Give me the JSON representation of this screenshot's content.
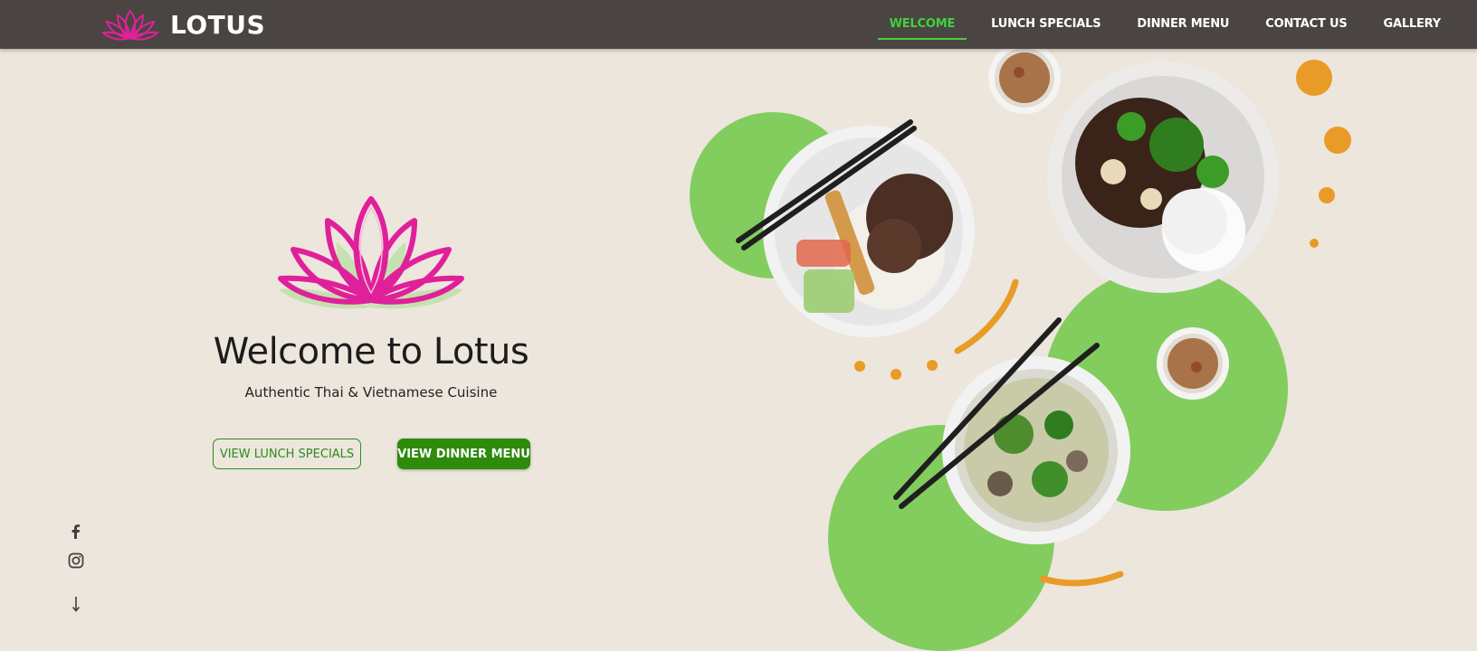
{
  "brand": {
    "name": "LOTUS",
    "logo_icon": "lotus-flower-icon"
  },
  "nav": {
    "items": [
      {
        "label": "WELCOME",
        "active": true
      },
      {
        "label": "LUNCH SPECIALS",
        "active": false
      },
      {
        "label": "DINNER MENU",
        "active": false
      },
      {
        "label": "CONTACT US",
        "active": false
      },
      {
        "label": "GALLERY",
        "active": false
      }
    ]
  },
  "hero": {
    "title": "Welcome to Lotus",
    "subtitle": "Authentic Thai & Vietnamese Cuisine",
    "logo_icon": "lotus-flower-icon",
    "buttons": {
      "lunch_label": "VIEW LUNCH SPECIALS",
      "dinner_label": "VIEW DINNER MENU"
    }
  },
  "social": {
    "facebook_icon": "facebook-icon",
    "instagram_icon": "instagram-icon",
    "scroll_icon": "arrow-down-icon"
  },
  "colors": {
    "background": "#ece6dd",
    "navbar": "#4a4542",
    "active_nav": "#3fd13c",
    "brand_pink": "#e0209a",
    "button_green": "#2e8b0c",
    "decor_green": "#82cd5e",
    "decor_orange": "#e99b27"
  }
}
